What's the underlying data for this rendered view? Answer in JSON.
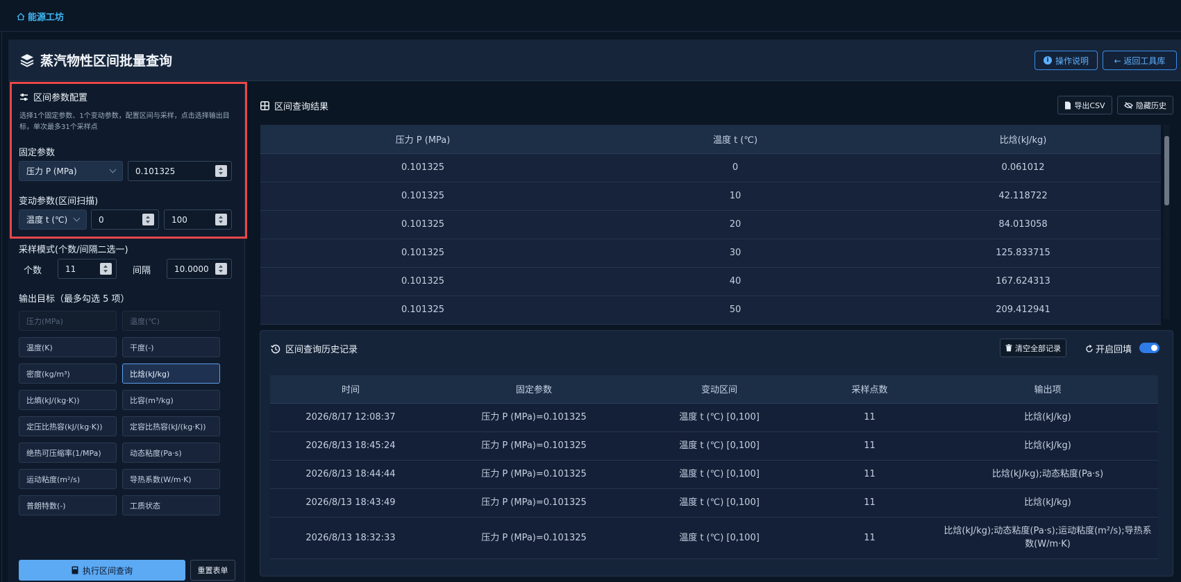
{
  "brand": "能源工坊",
  "header": {
    "title": "蒸汽物性区间批量查询",
    "help_label": "操作说明",
    "back_label": "← 返回工具库"
  },
  "config": {
    "title": "区间参数配置",
    "hint": "选择1个固定参数、1个变动参数，配置区间与采样，点击选择输出目标，单次最多31个采样点",
    "fixed_label": "固定参数",
    "fixed_param": "压力 P (MPa)",
    "fixed_value": "0.101325",
    "variable_label": "变动参数(区间扫描)",
    "variable_param": "温度 t (℃)",
    "range_start": "0",
    "range_end": "100",
    "sampling_label": "采样模式(个数/间隔二选一)",
    "count_label": "个数",
    "count_value": "11",
    "interval_label": "间隔",
    "interval_value": "10.0000",
    "outputs_label": "输出目标（最多勾选 5 项）",
    "outputs": [
      {
        "label": "压力(MPa)",
        "state": "disabled"
      },
      {
        "label": "温度(℃)",
        "state": "disabled"
      },
      {
        "label": "温度(K)",
        "state": "normal"
      },
      {
        "label": "干度(-)",
        "state": "normal"
      },
      {
        "label": "密度(kg/m³)",
        "state": "normal"
      },
      {
        "label": "比焓(kJ/kg)",
        "state": "selected"
      },
      {
        "label": "比熵(kJ/(kg·K))",
        "state": "normal"
      },
      {
        "label": "比容(m³/kg)",
        "state": "normal"
      },
      {
        "label": "定压比热容(kJ/(kg·K))",
        "state": "normal"
      },
      {
        "label": "定容比热容(kJ/(kg·K))",
        "state": "normal"
      },
      {
        "label": "绝热可压缩率(1/MPa)",
        "state": "normal"
      },
      {
        "label": "动态粘度(Pa·s)",
        "state": "normal"
      },
      {
        "label": "运动粘度(m²/s)",
        "state": "normal"
      },
      {
        "label": "导热系数(W/m·K)",
        "state": "normal"
      },
      {
        "label": "普朗特数(-)",
        "state": "normal"
      },
      {
        "label": "工质状态",
        "state": "normal"
      }
    ],
    "run_label": "执行区间查询",
    "reset_label": "重置表单"
  },
  "results": {
    "title": "区间查询结果",
    "export_label": "导出CSV",
    "hide_history_label": "隐藏历史",
    "columns": [
      "压力 P (MPa)",
      "温度 t (℃)",
      "比焓(kJ/kg)"
    ],
    "rows": [
      [
        "0.101325",
        "0",
        "0.061012"
      ],
      [
        "0.101325",
        "10",
        "42.118722"
      ],
      [
        "0.101325",
        "20",
        "84.013058"
      ],
      [
        "0.101325",
        "30",
        "125.833715"
      ],
      [
        "0.101325",
        "40",
        "167.624313"
      ],
      [
        "0.101325",
        "50",
        "209.412941"
      ]
    ]
  },
  "history": {
    "title": "区间查询历史记录",
    "clear_label": "清空全部记录",
    "refill_label": "开启回填",
    "columns": [
      "时间",
      "固定参数",
      "变动区间",
      "采样点数",
      "输出项"
    ],
    "rows": [
      [
        "2026/8/17 12:08:37",
        "压力 P (MPa)=0.101325",
        "温度 t (℃) [0,100]",
        "11",
        "比焓(kJ/kg)"
      ],
      [
        "2026/8/13 18:45:24",
        "压力 P (MPa)=0.101325",
        "温度 t (℃) [0,100]",
        "11",
        "比焓(kJ/kg)"
      ],
      [
        "2026/8/13 18:44:44",
        "压力 P (MPa)=0.101325",
        "温度 t (℃) [0,100]",
        "11",
        "比焓(kJ/kg);动态粘度(Pa·s)"
      ],
      [
        "2026/8/13 18:43:49",
        "压力 P (MPa)=0.101325",
        "温度 t (℃) [0,100]",
        "11",
        "比焓(kJ/kg)"
      ],
      [
        "2026/8/13 18:32:33",
        "压力 P (MPa)=0.101325",
        "温度 t (℃) [0,100]",
        "11",
        "比焓(kJ/kg);动态粘度(Pa·s);运动粘度(m²/s);导热系数(W/m·K)"
      ]
    ]
  }
}
